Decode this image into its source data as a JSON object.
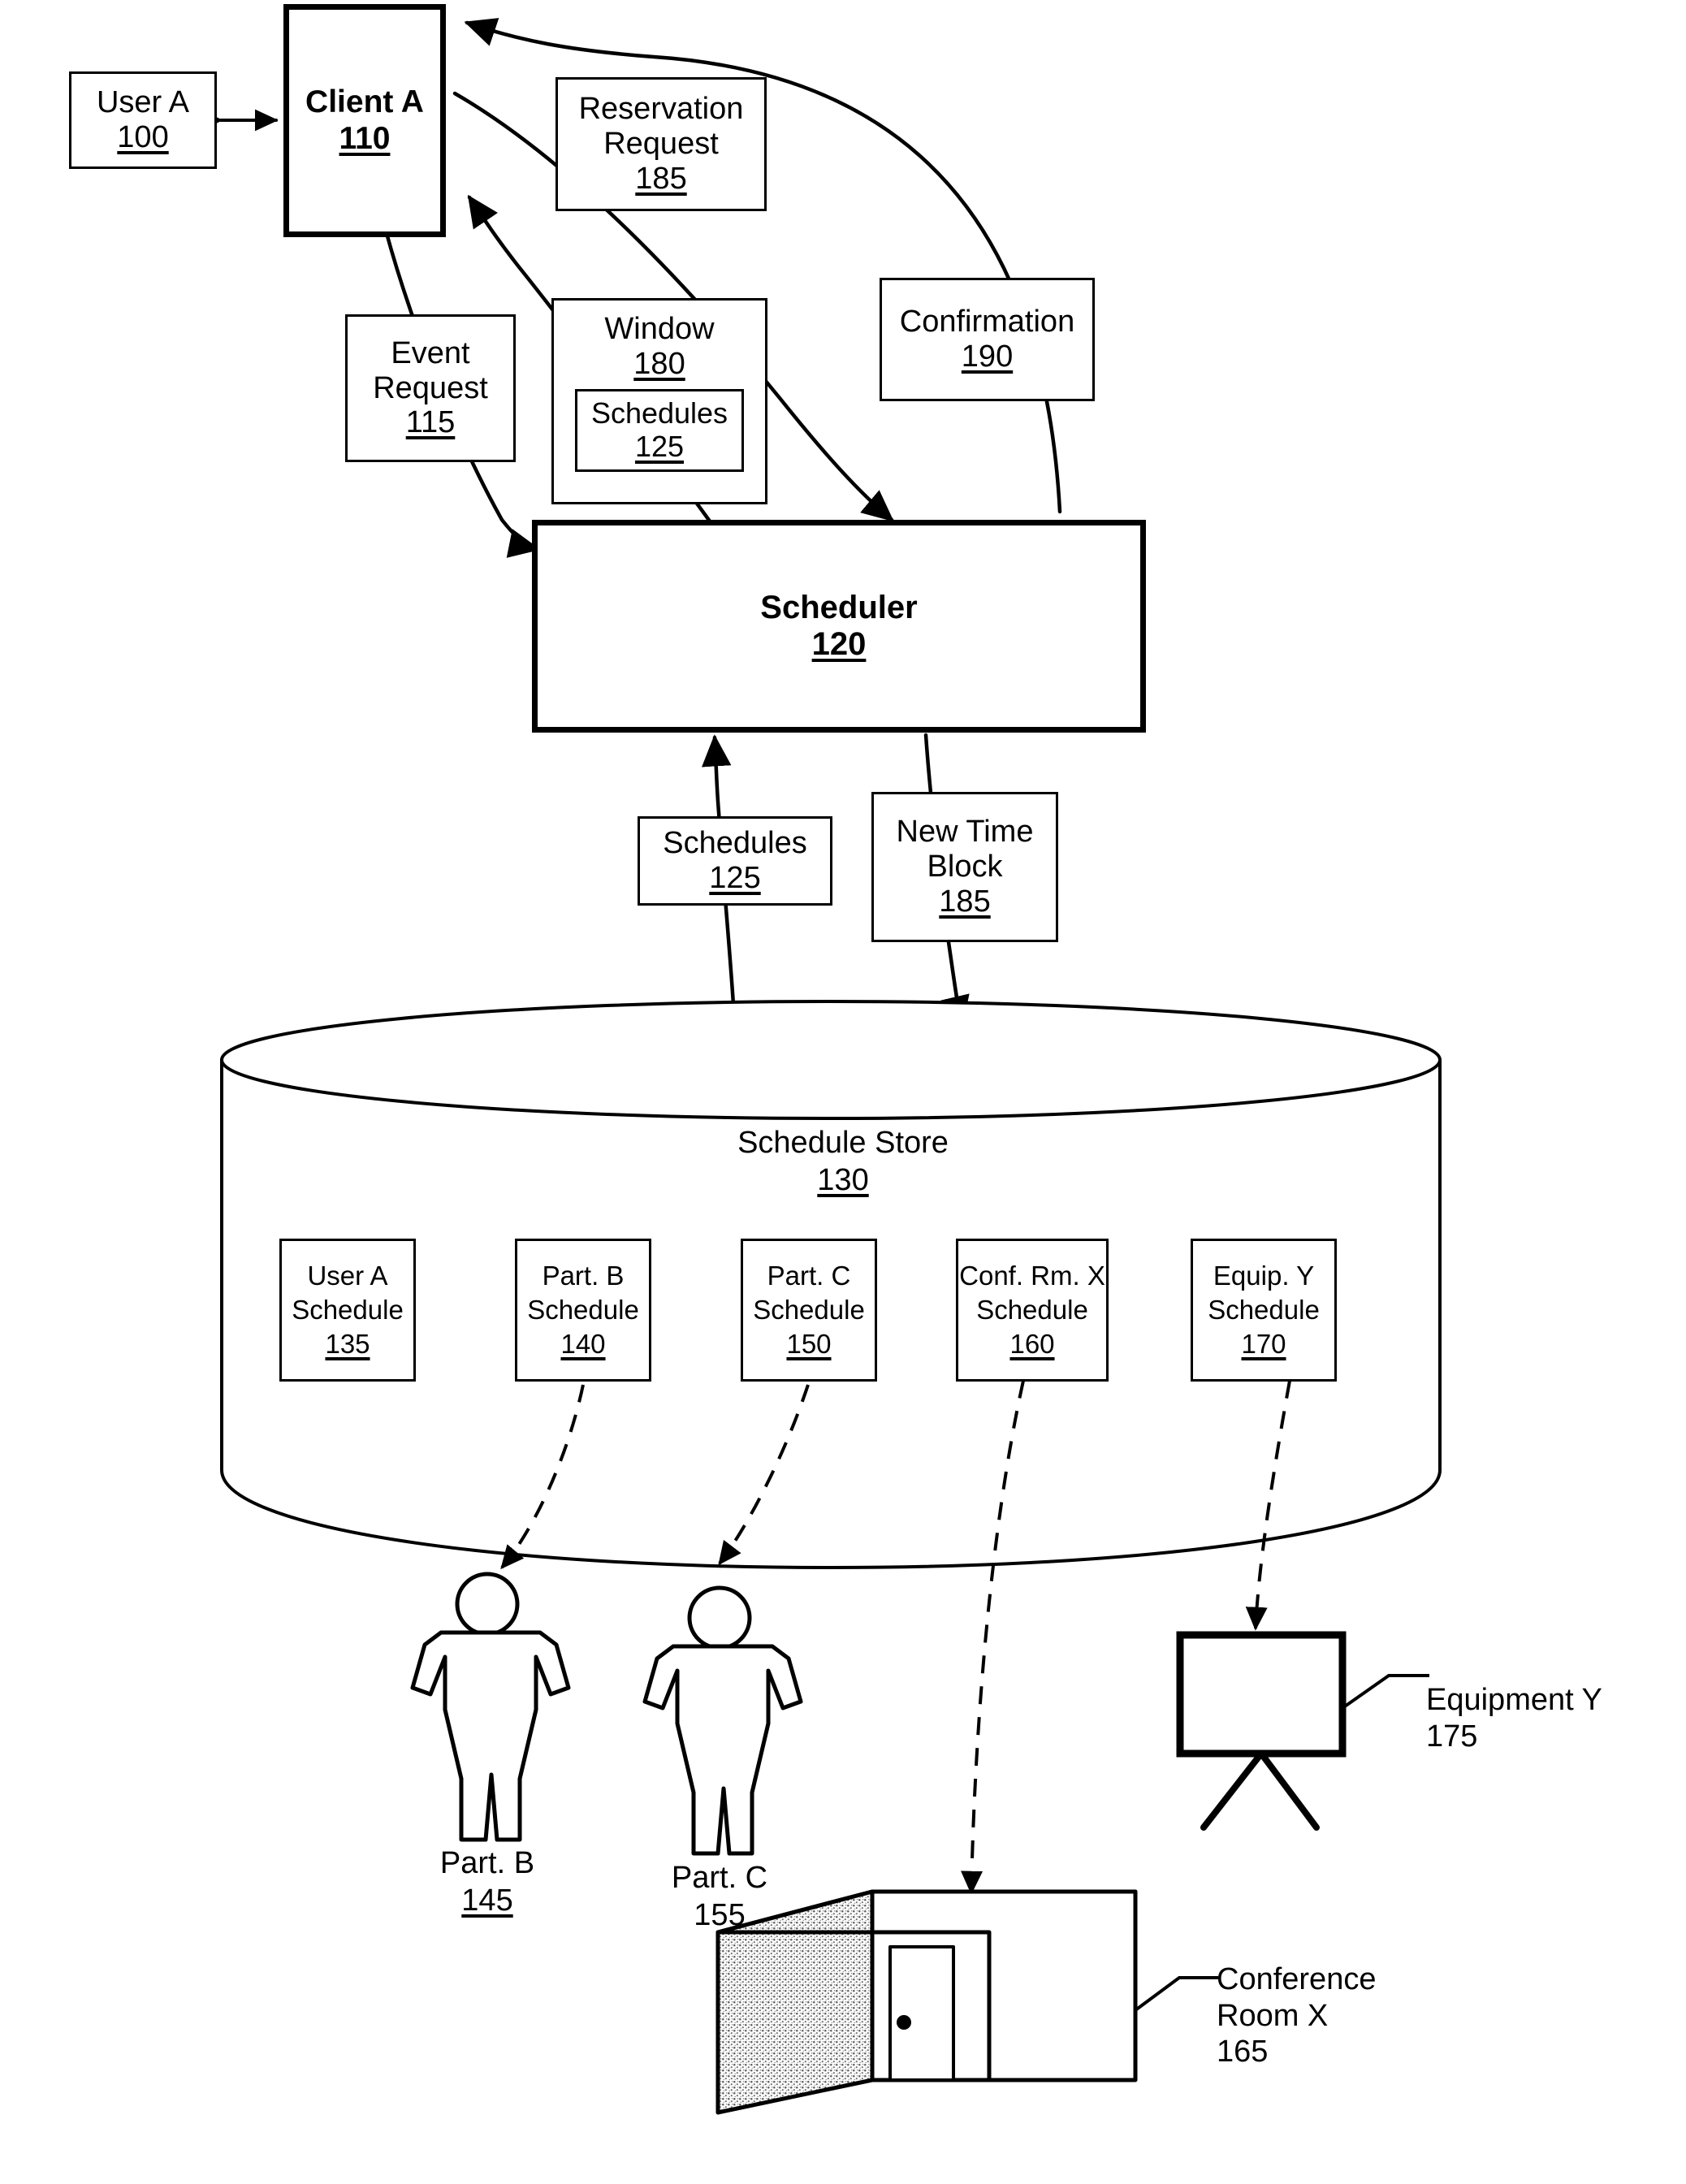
{
  "figure": {
    "type": "patent-block-diagram",
    "background": "#ffffff",
    "ink": "#000000"
  },
  "nodes": {
    "user_a": {
      "label": "User A",
      "ref": "100"
    },
    "client_a": {
      "label": "Client A",
      "ref": "110"
    },
    "reservation_request": {
      "label": "Reservation\nRequest",
      "ref": "185"
    },
    "event_request": {
      "label": "Event\nRequest",
      "ref": "115"
    },
    "window": {
      "label": "Window",
      "ref": "180"
    },
    "window_schedules": {
      "label": "Schedules",
      "ref": "125"
    },
    "confirmation": {
      "label": "Confirmation",
      "ref": "190"
    },
    "scheduler": {
      "label": "Scheduler",
      "ref": "120"
    },
    "schedules": {
      "label": "Schedules",
      "ref": "125"
    },
    "new_time_block": {
      "label": "New Time\nBlock",
      "ref": "185"
    }
  },
  "store": {
    "label": "Schedule Store",
    "ref": "130",
    "cards": [
      {
        "line1": "User A",
        "line2": "Schedule",
        "ref": "135"
      },
      {
        "line1": "Part. B",
        "line2": "Schedule",
        "ref": "140"
      },
      {
        "line1": "Part. C",
        "line2": "Schedule",
        "ref": "150"
      },
      {
        "line1": "Conf. Rm. X",
        "line2": "Schedule",
        "ref": "160"
      },
      {
        "line1": "Equip. Y",
        "line2": "Schedule",
        "ref": "170"
      }
    ]
  },
  "entities": {
    "participant_b": {
      "label": "Part. B",
      "ref": "145",
      "icon": "person-figure-icon"
    },
    "participant_c": {
      "label": "Part. C",
      "ref": "155",
      "icon": "person-figure-icon"
    },
    "equipment_y": {
      "label": "Equipment Y",
      "ref": "175",
      "icon": "projector-screen-icon"
    },
    "conference_room_x": {
      "label": "Conference\nRoom X",
      "ref": "165",
      "icon": "room-box-icon"
    }
  }
}
